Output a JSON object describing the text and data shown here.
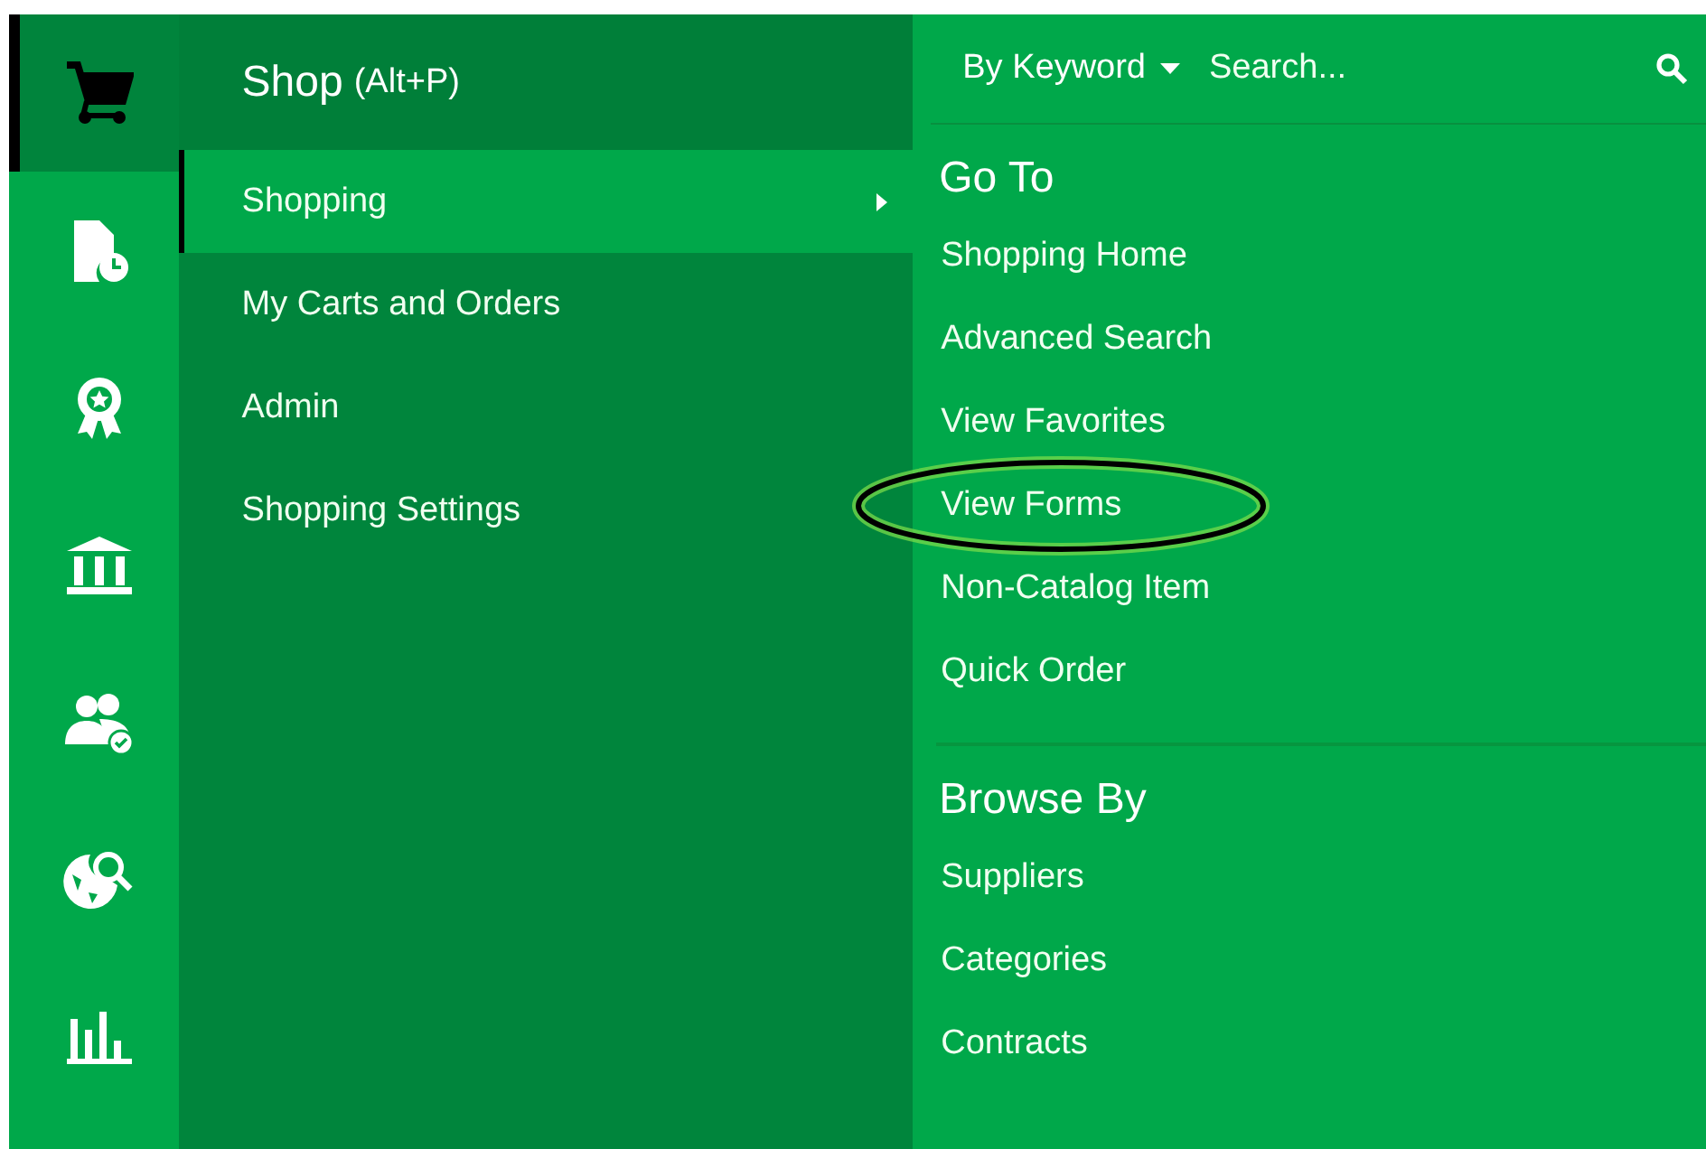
{
  "rail": [
    {
      "kind": "cart",
      "selected": true
    },
    {
      "kind": "document",
      "selected": false
    },
    {
      "kind": "award",
      "selected": false
    },
    {
      "kind": "bank",
      "selected": false
    },
    {
      "kind": "users",
      "selected": false
    },
    {
      "kind": "globe",
      "selected": false
    },
    {
      "kind": "chart",
      "selected": false
    }
  ],
  "menu": {
    "title": "Shop",
    "shortcut": "(Alt+P)",
    "items": [
      {
        "label": "Shopping",
        "selected": true,
        "has_submenu": true
      },
      {
        "label": "My Carts and Orders",
        "selected": false,
        "has_submenu": false
      },
      {
        "label": "Admin",
        "selected": false,
        "has_submenu": false
      },
      {
        "label": "Shopping Settings",
        "selected": false,
        "has_submenu": false
      }
    ]
  },
  "search": {
    "mode": "By Keyword",
    "placeholder": "Search..."
  },
  "sections": [
    {
      "heading": "Go To",
      "items": [
        {
          "label": "Shopping Home"
        },
        {
          "label": "Advanced Search"
        },
        {
          "label": "View Favorites"
        },
        {
          "label": "View Forms",
          "highlighted": true
        },
        {
          "label": "Non-Catalog Item"
        },
        {
          "label": "Quick Order"
        }
      ]
    },
    {
      "heading": "Browse By",
      "items": [
        {
          "label": "Suppliers"
        },
        {
          "label": "Categories"
        },
        {
          "label": "Contracts"
        }
      ]
    }
  ]
}
